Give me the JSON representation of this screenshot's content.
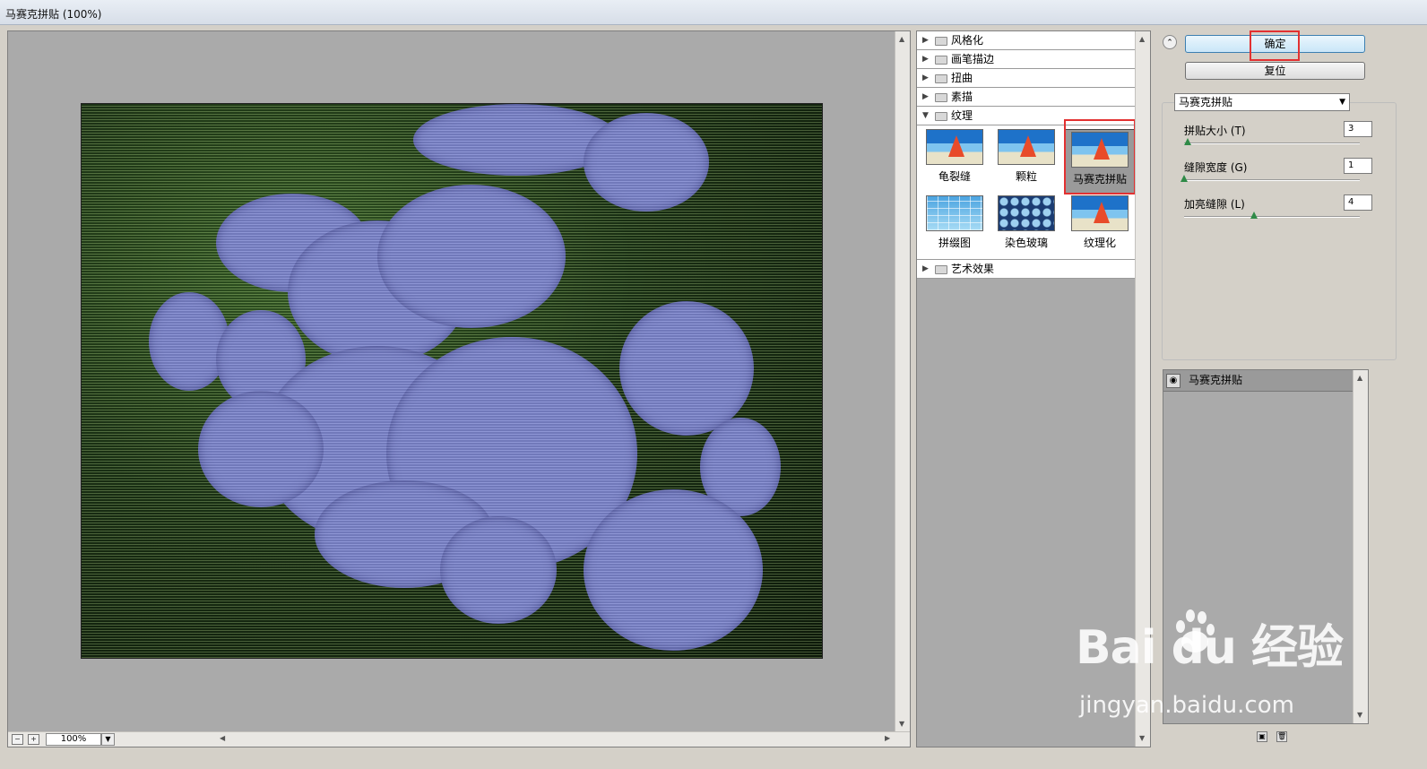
{
  "window": {
    "title": "马赛克拼贴 (100%)"
  },
  "preview": {
    "zoom": "100%",
    "zoom_out": "−",
    "zoom_in": "+"
  },
  "gallery": {
    "categories_top": [
      {
        "label": "风格化",
        "expanded": false
      },
      {
        "label": "画笔描边",
        "expanded": false
      },
      {
        "label": "扭曲",
        "expanded": false
      },
      {
        "label": "素描",
        "expanded": false
      },
      {
        "label": "纹理",
        "expanded": true
      }
    ],
    "filters": [
      {
        "label": "龟裂缝"
      },
      {
        "label": "颗粒"
      },
      {
        "label": "马赛克拼贴",
        "selected": true
      },
      {
        "label": "拼缀图"
      },
      {
        "label": "染色玻璃"
      },
      {
        "label": "纹理化"
      }
    ],
    "categories_bottom": [
      {
        "label": "艺术效果",
        "expanded": false
      }
    ]
  },
  "panel": {
    "ok_label": "确定",
    "reset_label": "复位",
    "filter_select": "马赛克拼贴",
    "params": [
      {
        "label": "拼贴大小 (T)",
        "value": "3",
        "fraction": 0.02
      },
      {
        "label": "缝隙宽度 (G)",
        "value": "1",
        "fraction": 0.0
      },
      {
        "label": "加亮缝隙 (L)",
        "value": "4",
        "fraction": 0.4
      }
    ],
    "layers": [
      {
        "label": "马赛克拼贴"
      }
    ]
  },
  "watermark": {
    "top": "Bai du 经验",
    "bottom": "jingyan.baidu.com"
  },
  "colors": {
    "highlight": "#e23131",
    "knob": "#2f8a47",
    "ok_button": "#c9e6f8"
  }
}
